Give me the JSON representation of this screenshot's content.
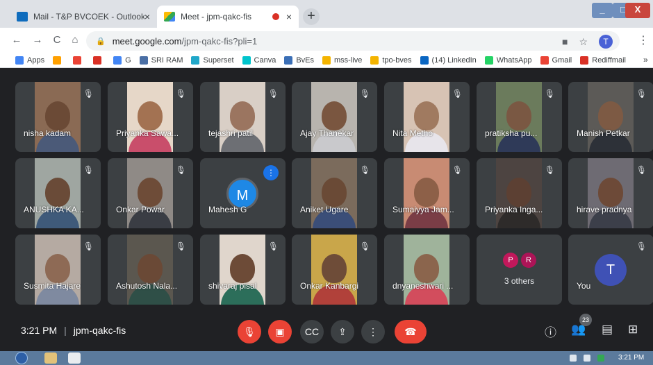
{
  "browser": {
    "tabs": [
      {
        "title": "Mail - T&P BVCOEK - Outlook",
        "close": "×"
      },
      {
        "title": "Meet - jpm-qakc-fis",
        "close": "×"
      }
    ],
    "new_tab": "+",
    "window_controls": {
      "minimize": "_",
      "maximize": "□",
      "close": "X"
    },
    "nav": {
      "back": "←",
      "forward": "→",
      "reload": "C",
      "home": "⌂"
    },
    "url_host": "meet.google.com",
    "url_path": "/jpm-qakc-fis?pli=1",
    "profile_initial": "T",
    "menu": "⋮",
    "bookmarks": [
      {
        "label": "Apps",
        "color": "#4285f4"
      },
      {
        "label": "",
        "color": "#ffa000"
      },
      {
        "label": "",
        "color": "#ea4335"
      },
      {
        "label": "",
        "color": "#d93025"
      },
      {
        "label": "G",
        "color": "#4285f4"
      },
      {
        "label": "SRI RAM",
        "color": "#4a6fa5"
      },
      {
        "label": "Superset",
        "color": "#20a7c9"
      },
      {
        "label": "Canva",
        "color": "#00c4cc"
      },
      {
        "label": "BvEs",
        "color": "#3b6fb6"
      },
      {
        "label": "mss-live",
        "color": "#f4b400"
      },
      {
        "label": "tpo-bves",
        "color": "#f4b400"
      },
      {
        "label": "(14) LinkedIn",
        "color": "#0a66c2"
      },
      {
        "label": "WhatsApp",
        "color": "#25d366"
      },
      {
        "label": "Gmail",
        "color": "#ea4335"
      },
      {
        "label": "Rediffmail",
        "color": "#d93025"
      }
    ],
    "bookmarks_more": "»"
  },
  "meet": {
    "participants": [
      {
        "name": "nisha kadam",
        "muted": true,
        "bg": "#8a6a54",
        "skin": "#6b4a36",
        "shirt": "#4b5a78"
      },
      {
        "name": "Priyanka Sawa...",
        "muted": true,
        "bg": "#e6d7c8",
        "skin": "#a37252",
        "shirt": "#c94e6b"
      },
      {
        "name": "tejashri patil",
        "muted": true,
        "bg": "#d9cfc6",
        "skin": "#9b7560",
        "shirt": "#6d6f74"
      },
      {
        "name": "Ajay Thanekar",
        "muted": true,
        "bg": "#b8b4ae",
        "skin": "#7a5640",
        "shirt": "#c9c9cc"
      },
      {
        "name": "Nita Metho",
        "muted": true,
        "bg": "#d7c3b4",
        "skin": "#a07a60",
        "shirt": "#e7e4ea"
      },
      {
        "name": "pratiksha pu...",
        "muted": true,
        "bg": "#6b7b5c",
        "skin": "#7a5843",
        "shirt": "#2f3a58"
      },
      {
        "name": "Manish Petkar",
        "muted": true,
        "bg": "#5c5a57",
        "skin": "#7d5a44",
        "shirt": "#2d3138"
      },
      {
        "name": "ANUSHKA KA...",
        "muted": true,
        "bg": "#9fa6a1",
        "skin": "#6a4b38",
        "shirt": "#3f5a7a"
      },
      {
        "name": "Onkar Powar",
        "muted": true,
        "bg": "#8f8a86",
        "skin": "#6e4c38",
        "shirt": "#3a3d44"
      },
      {
        "name": "Mahesh G",
        "muted": false,
        "avatar": "M",
        "avatar_color": "#1e88e5",
        "speaking": true
      },
      {
        "name": "Aniket Ugare",
        "muted": true,
        "bg": "#7b6b5c",
        "skin": "#6a4a36",
        "shirt": "#3b4e78"
      },
      {
        "name": "Sumaiyya Jam...",
        "muted": true,
        "bg": "#c88b73",
        "skin": "#8d6048",
        "shirt": "#7a3d46"
      },
      {
        "name": "Priyanka Inga...",
        "muted": true,
        "bg": "#4d4441",
        "skin": "#5c4033",
        "shirt": "#2e2b2a"
      },
      {
        "name": "hirave pradnya",
        "muted": true,
        "bg": "#6e6b73",
        "skin": "#6d4a38",
        "shirt": "#3c3f4a"
      },
      {
        "name": "Susmita Hajare",
        "muted": true,
        "bg": "#b5aaa2",
        "skin": "#8e6a55",
        "shirt": "#7f8aa0"
      },
      {
        "name": "Ashutosh Nala...",
        "muted": true,
        "bg": "#5b574f",
        "skin": "#6a4936",
        "shirt": "#2f4f47"
      },
      {
        "name": "shivaraj pisal",
        "muted": true,
        "bg": "#e0d6cc",
        "skin": "#6d4b37",
        "shirt": "#2c6e5a"
      },
      {
        "name": "Onkar Kanbargi",
        "muted": true,
        "bg": "#c9a64a",
        "skin": "#6e4c38",
        "shirt": "#b1413a"
      },
      {
        "name": "dnyaneshwari ...",
        "muted": false,
        "bg": "#9fb39b",
        "skin": "#8b654d",
        "shirt": "#d24d5d"
      }
    ],
    "others": {
      "label": "3 others",
      "avatars": [
        {
          "letter": "P",
          "color": "#c2185b"
        },
        {
          "letter": "R",
          "color": "#ad1457"
        }
      ]
    },
    "self": {
      "name": "You",
      "avatar": "T",
      "avatar_color": "#3f51b5",
      "muted": true
    },
    "mic_off_glyph": "🎙̸",
    "time": "3:21 PM",
    "meeting_code": "jpm-qakc-fis",
    "info_sep": "|",
    "people_count": "23"
  },
  "taskbar": {
    "clock": "3:21 PM"
  }
}
